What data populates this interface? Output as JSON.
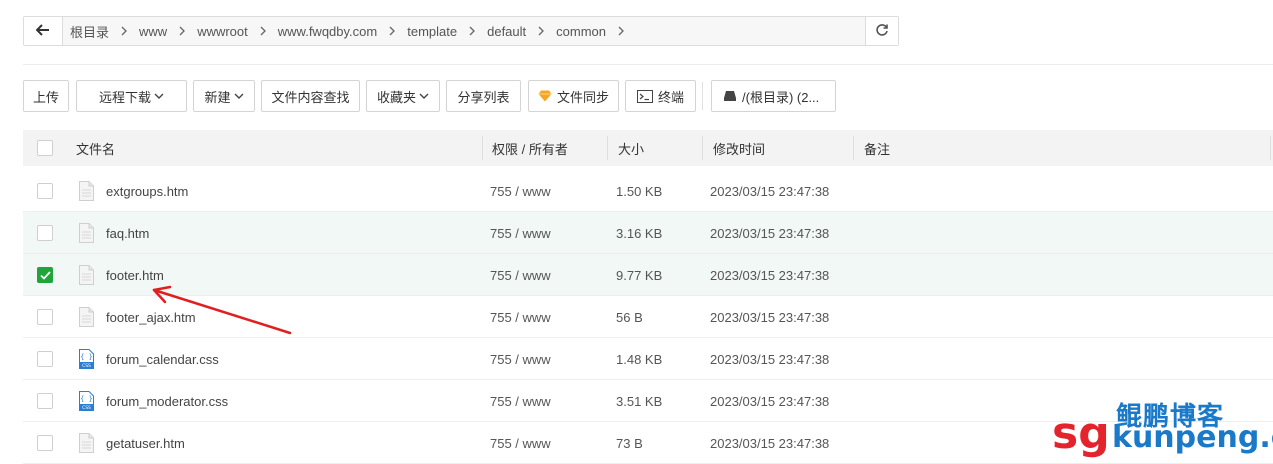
{
  "pathbar": {
    "crumbs": [
      "根目录",
      "www",
      "wwwroot",
      "www.fwqdby.com",
      "template",
      "default",
      "common"
    ]
  },
  "toolbar": {
    "upload": "上传",
    "remote_download": "远程下载",
    "new": "新建",
    "content_search": "文件内容查找",
    "favorites": "收藏夹",
    "share_list": "分享列表",
    "file_sync": "文件同步",
    "terminal": "终端",
    "disk": "/(根目录) (2..."
  },
  "table": {
    "headers": {
      "name": "文件名",
      "perm_owner": "权限 / 所有者",
      "size": "大小",
      "mtime": "修改时间",
      "note": "备注"
    },
    "rows": [
      {
        "name": "extgroups.htm",
        "perm": "755 / www",
        "size": "1.50 KB",
        "mtime": "2023/03/15 23:47:38",
        "icon": "file-icon",
        "checked": false,
        "highlight": false
      },
      {
        "name": "faq.htm",
        "perm": "755 / www",
        "size": "3.16 KB",
        "mtime": "2023/03/15 23:47:38",
        "icon": "file-icon",
        "checked": false,
        "highlight": true
      },
      {
        "name": "footer.htm",
        "perm": "755 / www",
        "size": "9.77 KB",
        "mtime": "2023/03/15 23:47:38",
        "icon": "file-icon",
        "checked": true,
        "highlight": true
      },
      {
        "name": "footer_ajax.htm",
        "perm": "755 / www",
        "size": "56 B",
        "mtime": "2023/03/15 23:47:38",
        "icon": "file-icon",
        "checked": false,
        "highlight": false
      },
      {
        "name": "forum_calendar.css",
        "perm": "755 / www",
        "size": "1.48 KB",
        "mtime": "2023/03/15 23:47:38",
        "icon": "css-file-icon",
        "checked": false,
        "highlight": false
      },
      {
        "name": "forum_moderator.css",
        "perm": "755 / www",
        "size": "3.51 KB",
        "mtime": "2023/03/15 23:47:38",
        "icon": "css-file-icon",
        "checked": false,
        "highlight": false
      },
      {
        "name": "getatuser.htm",
        "perm": "755 / www",
        "size": "73 B",
        "mtime": "2023/03/15 23:47:38",
        "icon": "file-icon",
        "checked": false,
        "highlight": false
      }
    ]
  },
  "watermark": {
    "top": "鲲鹏博客",
    "sg": "sg",
    "rest": "kunpeng.cn"
  },
  "colors": {
    "accent_green": "#20a53a",
    "row_highlight": "#f1f8f5",
    "arrow_red": "#e02020",
    "watermark_red": "#e5232c",
    "watermark_blue": "#1a79c8"
  }
}
